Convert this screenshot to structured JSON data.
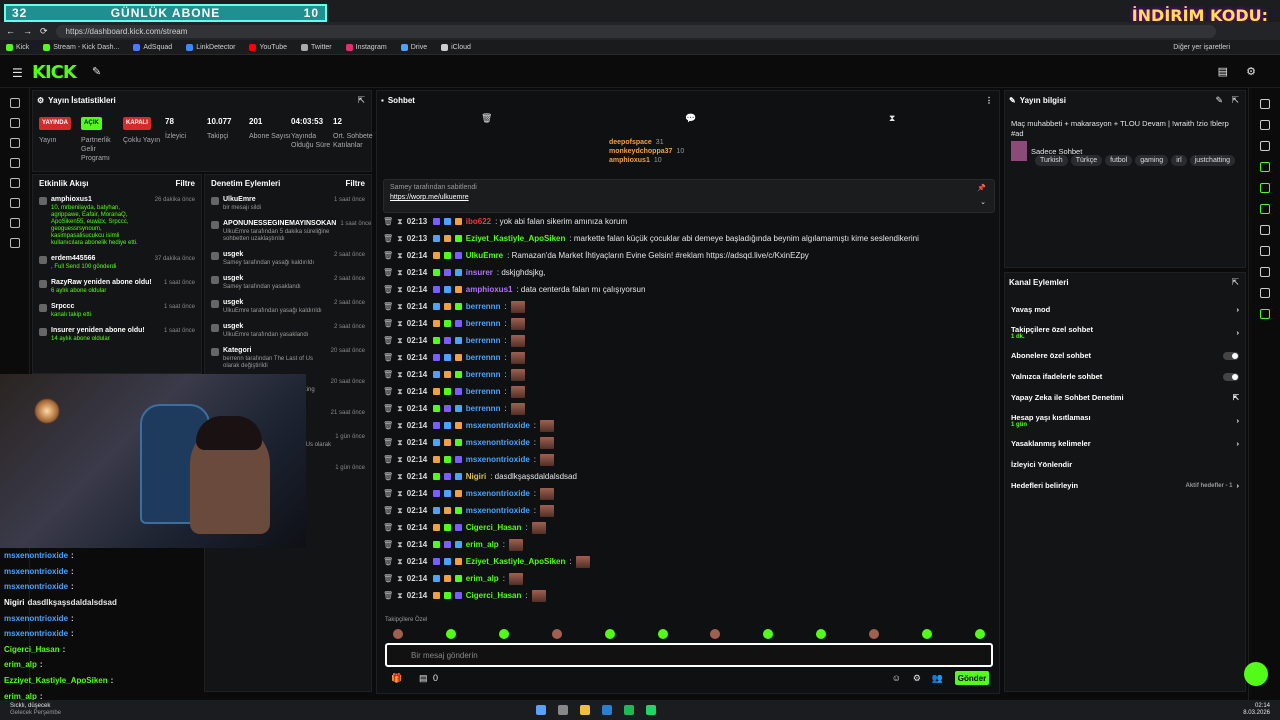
{
  "browser": {
    "overlay_left": "32",
    "overlay_title": "GÜNLÜK ABONE",
    "overlay_right": "10",
    "promo": "İNDİRİM KODU:",
    "url": "https://dashboard.kick.com/stream",
    "bookmarks": [
      "Kick",
      "Stream - Kick Dash...",
      "AdSquad",
      "LinkDetector",
      "YouTube",
      "Twitter",
      "Instagram",
      "Drive",
      "iCloud"
    ],
    "other_bookmarks": "Diğer yer işaretleri",
    "chat_corner": "Sohbet et"
  },
  "kick": {
    "logo": "KICK"
  },
  "stats": {
    "title": "Yayın İstatistikleri",
    "items": [
      {
        "badge": "YAYINDA",
        "label": "Yayın",
        "color": "#d12b2b"
      },
      {
        "badge": "AÇIK",
        "label": "Partnerlik Gelir Programı",
        "color": "#53fc18"
      },
      {
        "badge": "KAPALI",
        "label": "Çoklu Yayın",
        "color": "#d12b2b"
      },
      {
        "value": "78",
        "label": "İzleyici"
      },
      {
        "value": "10.077",
        "label": "Takipçi"
      },
      {
        "value": "201",
        "label": "Abone Sayısı"
      },
      {
        "value": "04:03:53",
        "label": "Yayında Olduğu Süre"
      },
      {
        "value": "12",
        "label": "Ort. Sohbete Katılanlar"
      }
    ]
  },
  "events": {
    "title": "Etkinlik Akışı",
    "filter": "Filtre",
    "items": [
      {
        "user": "amphioxus1",
        "detail": "10, mrbenilayda, batyhan, agrippawe, Eafair, MoranaQ, ApoSiken55, euwizx, Srpccc, geoguessrsynoum, kasimpasalisucukcu isimli kullanıcılara abonelik hediye etti.",
        "time": "26 dakika önce"
      },
      {
        "user": "erdem445566",
        "detail": ", Full Send 100 gönderdi",
        "time": "37 dakika önce"
      },
      {
        "user": "RazyRaw yeniden abone oldu!",
        "detail": "6 aylık abone oldular",
        "time": "1 saat önce"
      },
      {
        "user": "Srpccc",
        "detail": "kanalı takip etti",
        "time": "1 saat önce"
      },
      {
        "user": "Insurer yeniden abone oldu!",
        "detail": "14 aylık abone oldular",
        "time": "1 saat önce"
      }
    ]
  },
  "modlog": {
    "title": "Denetim Eylemleri",
    "filter": "Filtre",
    "items": [
      {
        "user": "UlkuEmre",
        "detail": "bir mesajı sildi",
        "time": "1 saat önce"
      },
      {
        "user": "APONUNESSEGINEMAYINSOKAN",
        "detail": "UlkuEmre tarafından 5 dakika süreliğine sohbetten uzaklaştırıldı",
        "time": "1 saat önce"
      },
      {
        "user": "usgek",
        "detail": "Samey tarafından yasağı kaldırıldı",
        "time": "2 saat önce"
      },
      {
        "user": "usgek",
        "detail": "Samey tarafından yasaklandı",
        "time": "2 saat önce"
      },
      {
        "user": "usgek",
        "detail": "UlkuEmre tarafından yasağı kaldırıldı",
        "time": "2 saat önce"
      },
      {
        "user": "usgek",
        "detail": "UlkuEmre tarafından yasaklandı",
        "time": "2 saat önce"
      },
      {
        "user": "Kategori",
        "detail": "berrenn tarafından The Last of Us olarak değiştirildi",
        "time": "20 saat önce"
      },
      {
        "user": "Kategori",
        "detail": "UlkuEmre tarafından Just Chatting olarak değiştirildi",
        "time": "20 saat önce"
      },
      {
        "user": "Mesaj Sabitlendi",
        "detail": "berrenn tarafından",
        "time": "21 saat önce"
      },
      {
        "user": "Kategori",
        "detail": "berrenn tarafından The Last of Us olarak değiştirildi",
        "time": "1 gün önce"
      },
      {
        "user": "oguzbig",
        "detail": "",
        "time": "1 gün önce"
      }
    ]
  },
  "overlay_chat": [
    {
      "user": "msxenontrioxide",
      "text": ":"
    },
    {
      "user": "msxenontrioxide",
      "text": ":"
    },
    {
      "user": "msxenontrioxide",
      "text": ":"
    },
    {
      "user": "Nigiri",
      "text": "dasdlkşaşsdaldalsdsad"
    },
    {
      "user": "msxenontrioxide",
      "text": ":"
    },
    {
      "user": "msxenontrioxide",
      "text": ":"
    },
    {
      "user": "Cigerci_Hasan",
      "text": ":"
    },
    {
      "user": "erim_alp",
      "text": ":"
    },
    {
      "user": "Ezziyet_Kastiyle_ApoSiken",
      "text": ":"
    },
    {
      "user": "erim_alp",
      "text": ":"
    }
  ],
  "chat": {
    "title": "Sohbet",
    "gift_top": [
      {
        "user": "deepofspace",
        "count": "31"
      },
      {
        "user": "monkeydchoppa37",
        "count": "10"
      },
      {
        "user": "amphioxus1",
        "count": "10"
      }
    ],
    "pinned_by": "Samey tarafından sabitlendi",
    "pinned_link": "https://worp.me/ulkuemre",
    "lines": [
      {
        "time": "02:13",
        "user": "ibo622",
        "color": "#e04040",
        "text": ": yok abi falan sikerim amınıza korum"
      },
      {
        "time": "02:13",
        "user": "Eziyet_Kastiyle_ApoSiken",
        "color": "#53fc18",
        "text": ": markette falan küçük çocuklar abi demeye başladığında beynim algılamamıştı kime seslendikerini"
      },
      {
        "time": "02:14",
        "user": "UlkuEmre",
        "color": "#53fc18",
        "text": ": Ramazan'da Market İhtiyaçların Evine Gelsin! #reklam https://adsqd.live/c/KxinEZpy"
      },
      {
        "time": "02:14",
        "user": "insurer",
        "color": "#b070ff",
        "text": ": dskjghdsjkg,"
      },
      {
        "time": "02:14",
        "user": "amphioxus1",
        "color": "#b070ff",
        "text": ": data centerda falan mı çalışıyorsun"
      },
      {
        "time": "02:14",
        "user": "berrennn",
        "color": "#4aa3ff",
        "text": ":"
      },
      {
        "time": "02:14",
        "user": "berrennn",
        "color": "#4aa3ff",
        "text": ":"
      },
      {
        "time": "02:14",
        "user": "berrennn",
        "color": "#4aa3ff",
        "text": ":"
      },
      {
        "time": "02:14",
        "user": "berrennn",
        "color": "#4aa3ff",
        "text": ":"
      },
      {
        "time": "02:14",
        "user": "berrennn",
        "color": "#4aa3ff",
        "text": ":"
      },
      {
        "time": "02:14",
        "user": "berrennn",
        "color": "#4aa3ff",
        "text": ":"
      },
      {
        "time": "02:14",
        "user": "berrennn",
        "color": "#4aa3ff",
        "text": ":"
      },
      {
        "time": "02:14",
        "user": "msxenontrioxide",
        "color": "#4aa3ff",
        "text": ":"
      },
      {
        "time": "02:14",
        "user": "msxenontrioxide",
        "color": "#4aa3ff",
        "text": ":"
      },
      {
        "time": "02:14",
        "user": "msxenontrioxide",
        "color": "#4aa3ff",
        "text": ":"
      },
      {
        "time": "02:14",
        "user": "Nigiri",
        "color": "#e0c050",
        "text": ": dasdlkşaşsdaldalsdsad"
      },
      {
        "time": "02:14",
        "user": "msxenontrioxide",
        "color": "#4aa3ff",
        "text": ":"
      },
      {
        "time": "02:14",
        "user": "msxenontrioxide",
        "color": "#4aa3ff",
        "text": ":"
      },
      {
        "time": "02:14",
        "user": "Cigerci_Hasan",
        "color": "#53fc18",
        "text": ":"
      },
      {
        "time": "02:14",
        "user": "erim_alp",
        "color": "#53fc18",
        "text": ":"
      },
      {
        "time": "02:14",
        "user": "Eziyet_Kastiyle_ApoSiken",
        "color": "#53fc18",
        "text": ":"
      },
      {
        "time": "02:14",
        "user": "erim_alp",
        "color": "#53fc18",
        "text": ":"
      },
      {
        "time": "02:14",
        "user": "Cigerci_Hasan",
        "color": "#53fc18",
        "text": ":"
      }
    ],
    "followers_only": "Takipçilere Özel",
    "input_placeholder": "Bir mesaj gönderin",
    "send": "Gönder",
    "count": "0"
  },
  "info": {
    "title": "Yayın bilgisi",
    "stream_title": "Maç muhabbeti + makarasyon + TLOU Devam | !wraith !zio !blerp #ad",
    "category": "Sadece Sohbet",
    "tags": [
      "Turkish",
      "Türkçe",
      "futbol",
      "gaming",
      "irl",
      "justchatting"
    ]
  },
  "actions": {
    "title": "Kanal Eylemleri",
    "items": [
      {
        "label": "Yavaş mod",
        "sub": "",
        "ctrl": "chevron"
      },
      {
        "label": "Takipçilere özel sohbet",
        "sub": "1 dk.",
        "ctrl": "chevron"
      },
      {
        "label": "Abonelere özel sohbet",
        "sub": "",
        "ctrl": "toggle"
      },
      {
        "label": "Yalnızca ifadelerle sohbet",
        "sub": "",
        "ctrl": "toggle"
      },
      {
        "label": "Yapay Zeka ile Sohbet Denetimi",
        "sub": "",
        "ctrl": "link"
      },
      {
        "label": "Hesap yaşı kısıtlaması",
        "sub": "1 gün",
        "ctrl": "chevron"
      },
      {
        "label": "Yasaklanmış kelimeler",
        "sub": "",
        "ctrl": "chevron"
      },
      {
        "label": "İzleyici Yönlendir",
        "sub": "",
        "ctrl": "none"
      },
      {
        "label": "Hedefleri belirleyin",
        "sub": "",
        "ctrl": "chevron",
        "extra": "Aktif hedefler - 1"
      }
    ]
  },
  "taskbar": {
    "weather": "Sıcklı, düşecek",
    "weather_sub": "Gelecek Perşembe",
    "time": "02:14",
    "date": "8.03.2026"
  },
  "colors": {
    "accent": "#53fc18",
    "live": "#d12b2b",
    "mention": "#4aa3ff"
  }
}
